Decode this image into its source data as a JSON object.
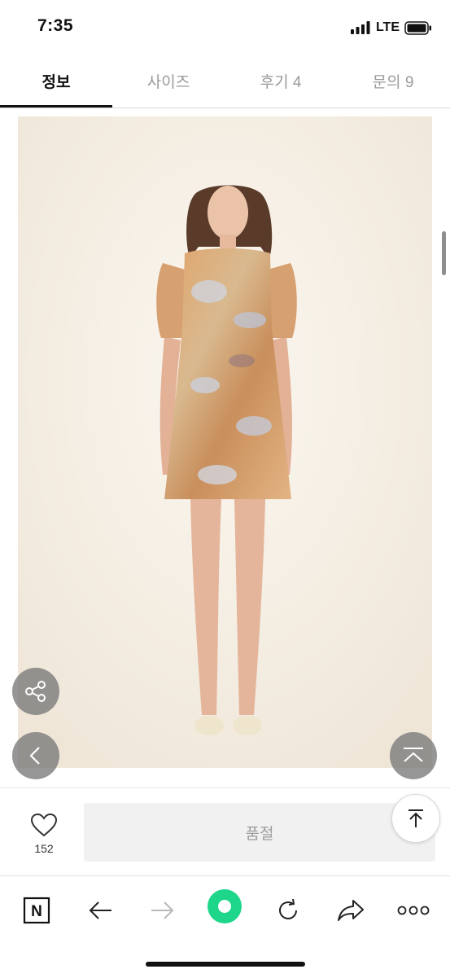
{
  "status_bar": {
    "time": "7:35",
    "network": "LTE"
  },
  "tabs": [
    {
      "label": "정보"
    },
    {
      "label": "사이즈"
    },
    {
      "label": "후기 4"
    },
    {
      "label": "문의 9"
    }
  ],
  "active_tab": "정보",
  "product": {
    "like_count": "152",
    "buy_button_label": "품절"
  },
  "icons": {
    "share": "share-icon",
    "back": "chevron-left-icon",
    "collapse": "chevron-up-icon",
    "like": "heart-icon",
    "scroll_top": "arrow-up-to-line-icon",
    "toolbar": [
      "naver-n-icon",
      "back-arrow-icon",
      "forward-arrow-icon",
      "green-circle-icon",
      "refresh-icon",
      "share-forward-icon",
      "more-dots-icon"
    ]
  },
  "colors": {
    "accent_green": "#1ed68a",
    "tab_active": "#111111",
    "fab_gray": "#7a7a7a",
    "soldout_bg": "#f1f1f1"
  }
}
